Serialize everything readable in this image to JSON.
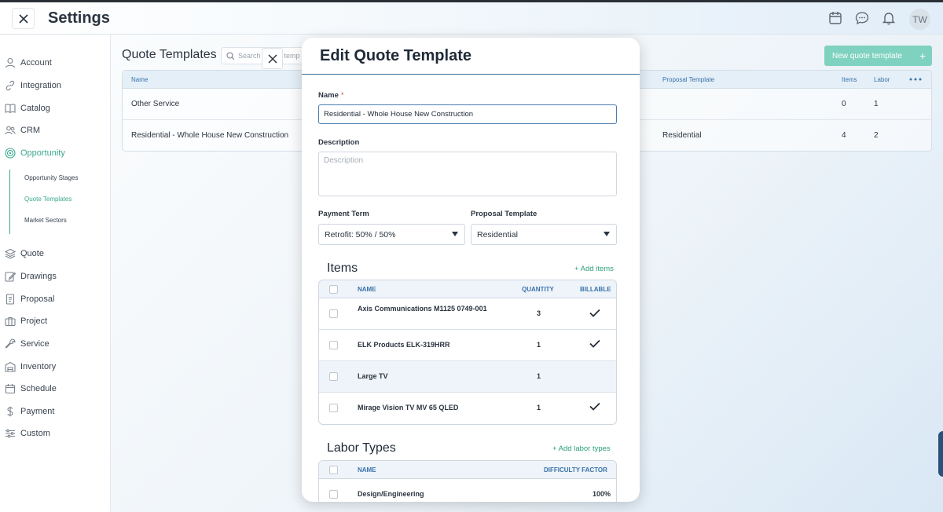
{
  "header": {
    "title": "Settings",
    "avatar": "TW",
    "icons": [
      "calendar-icon",
      "chat-icon",
      "bell-icon"
    ]
  },
  "sidebar": {
    "items": [
      {
        "label": "Account",
        "icon": "user-icon"
      },
      {
        "label": "Integration",
        "icon": "link-icon"
      },
      {
        "label": "Catalog",
        "icon": "book-icon"
      },
      {
        "label": "CRM",
        "icon": "users-icon"
      },
      {
        "label": "Opportunity",
        "icon": "target-icon",
        "active": true
      },
      {
        "label": "Quote",
        "icon": "layers-icon"
      },
      {
        "label": "Drawings",
        "icon": "pencil-icon"
      },
      {
        "label": "Proposal",
        "icon": "document-icon"
      },
      {
        "label": "Project",
        "icon": "briefcase-icon"
      },
      {
        "label": "Service",
        "icon": "wrench-icon"
      },
      {
        "label": "Inventory",
        "icon": "warehouse-icon"
      },
      {
        "label": "Schedule",
        "icon": "calendar-icon"
      },
      {
        "label": "Payment",
        "icon": "dollar-icon"
      },
      {
        "label": "Custom",
        "icon": "sliders-icon"
      }
    ],
    "sub_items": [
      {
        "label": "Opportunity Stages"
      },
      {
        "label": "Quote Templates",
        "active": true
      },
      {
        "label": "Market Sectors"
      }
    ]
  },
  "page": {
    "title": "Quote Templates",
    "search_placeholder": "Search",
    "search_hint": "temp",
    "new_button": "New quote template",
    "columns": {
      "name": "Name",
      "proposal": "Proposal Template",
      "items": "Items",
      "labor": "Labor"
    },
    "rows": [
      {
        "name": "Other Service",
        "proposal": "",
        "items": "0",
        "labor": "1"
      },
      {
        "name": "Residential - Whole House New Construction",
        "proposal": "Residential",
        "items": "4",
        "labor": "2"
      }
    ]
  },
  "modal": {
    "title": "Edit Quote Template",
    "name_label": "Name",
    "name_required": "*",
    "name_value": "Residential - Whole House New Construction",
    "description_label": "Description",
    "description_placeholder": "Description",
    "payment_term_label": "Payment Term",
    "payment_term_value": "Retrofit: 50% / 50%",
    "proposal_template_label": "Proposal Template",
    "proposal_template_value": "Residential",
    "items_title": "Items",
    "add_items": "+ Add items",
    "items_columns": {
      "name": "NAME",
      "quantity": "QUANTITY",
      "billable": "BILLABLE"
    },
    "items": [
      {
        "name": "Axis Communications M1125 0749-001",
        "quantity": "3",
        "billable": true
      },
      {
        "name": "ELK Products ELK-319HRR",
        "quantity": "1",
        "billable": true
      },
      {
        "name": "Large TV",
        "quantity": "1",
        "billable": false
      },
      {
        "name": "Mirage Vision TV MV 65 QLED",
        "quantity": "1",
        "billable": true
      }
    ],
    "labor_title": "Labor Types",
    "add_labor": "+ Add labor types",
    "labor_columns": {
      "name": "NAME",
      "difficulty": "DIFFICULTY FACTOR"
    },
    "labor": [
      {
        "name": "Design/Engineering",
        "difficulty": "100%"
      }
    ]
  },
  "colors": {
    "accent": "#3ba98e",
    "link_blue": "#3a72a8",
    "button_green": "#7fd2c0"
  }
}
